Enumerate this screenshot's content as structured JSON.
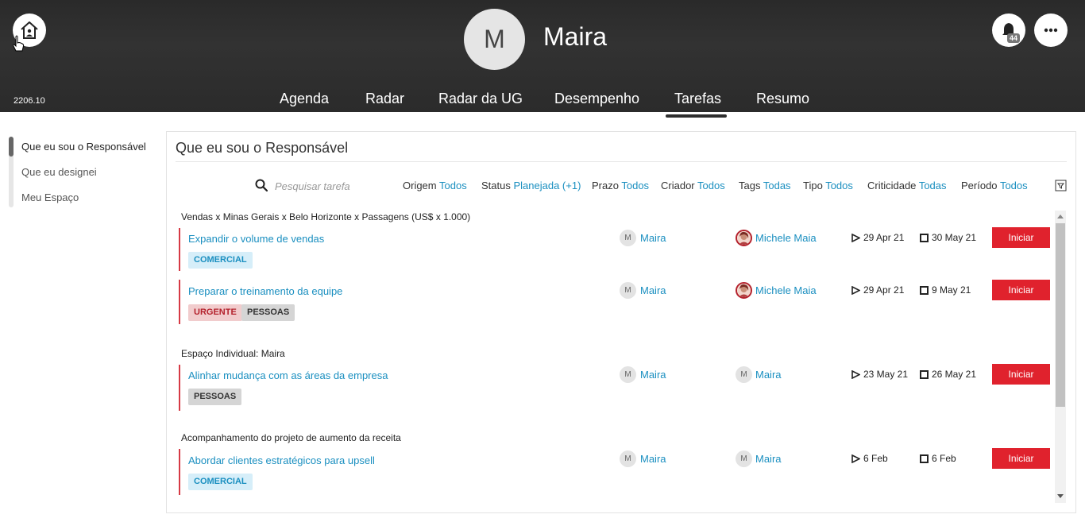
{
  "header": {
    "version": "2206.10",
    "avatar_initial": "M",
    "user_name": "Maira",
    "notification_count": "44",
    "nav": [
      {
        "label": "Agenda"
      },
      {
        "label": "Radar"
      },
      {
        "label": "Radar da UG"
      },
      {
        "label": "Desempenho"
      },
      {
        "label": "Tarefas",
        "active": true
      },
      {
        "label": "Resumo"
      }
    ]
  },
  "sidebar": {
    "items": [
      {
        "label": "Que eu sou o Responsável",
        "active": true
      },
      {
        "label": "Que eu designei"
      },
      {
        "label": "Meu Espaço"
      }
    ]
  },
  "panel": {
    "title": "Que eu sou o Responsável",
    "search_placeholder": "Pesquisar tarefa",
    "filters": [
      {
        "label": "Origem",
        "value": "Todos"
      },
      {
        "label": "Status",
        "value": "Planejada (+1)"
      },
      {
        "label": "Prazo",
        "value": "Todos"
      },
      {
        "label": "Criador",
        "value": "Todos"
      },
      {
        "label": "Tags",
        "value": "Todas"
      },
      {
        "label": "Tipo",
        "value": "Todos"
      },
      {
        "label": "Criticidade",
        "value": "Todas"
      },
      {
        "label": "Período",
        "value": "Todos"
      }
    ]
  },
  "groups": [
    {
      "title": "Vendas x Minas Gerais x Belo Horizonte x Passagens (US$ x 1.000)",
      "tasks": [
        {
          "title": "Expandir o volume de vendas",
          "tags": [
            "COMERCIAL"
          ],
          "responsible": "Maira",
          "creator": "Michele Maia",
          "start": "29 Apr 21",
          "end": "30 May 21",
          "button": "Iniciar"
        },
        {
          "title": "Preparar o treinamento da equipe",
          "tags": [
            "URGENTE",
            "PESSOAS"
          ],
          "responsible": "Maira",
          "creator": "Michele Maia",
          "start": "29 Apr 21",
          "end": "9 May 21",
          "button": "Iniciar"
        }
      ]
    },
    {
      "title": "Espaço Individual: Maira",
      "tasks": [
        {
          "title": "Alinhar mudança com as áreas da empresa",
          "tags": [
            "PESSOAS"
          ],
          "responsible": "Maira",
          "creator": "Maira",
          "start": "23 May 21",
          "end": "26 May 21",
          "button": "Iniciar"
        }
      ]
    },
    {
      "title": "Acompanhamento do projeto de aumento da receita",
      "tasks": [
        {
          "title": "Abordar clientes estratégicos para upsell",
          "tags": [
            "COMERCIAL"
          ],
          "responsible": "Maira",
          "creator": "Maira",
          "start": "6 Feb",
          "end": "6 Feb",
          "button": "Iniciar"
        }
      ]
    }
  ],
  "mini_avatar_initial": "M",
  "colors": {
    "accent": "#1a8fc0",
    "danger": "#e0222d",
    "header": "#2e2e2e"
  }
}
